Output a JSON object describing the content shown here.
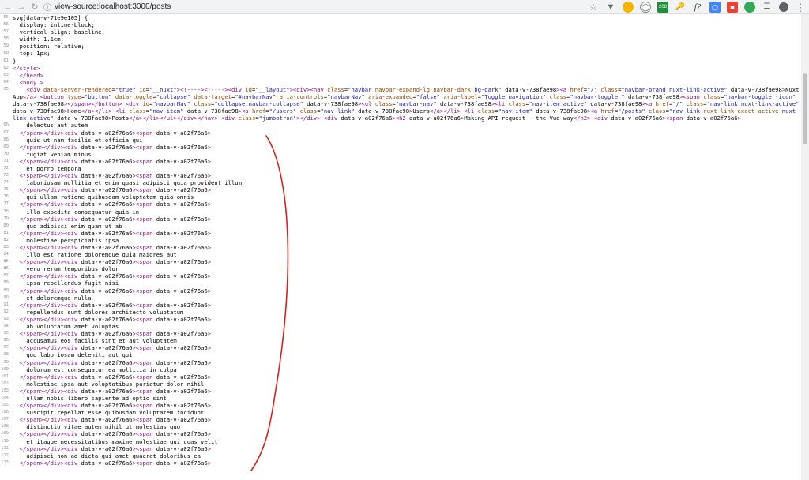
{
  "browser": {
    "url": "view-source:localhost:3000/posts",
    "extensions": [
      "star-icon",
      "vue-devtools-icon",
      "chrome-icon",
      "globe-icon",
      "badge-208-icon",
      "key-icon",
      "formula-icon",
      "screenshot-icon",
      "capture-icon",
      "extension-icon",
      "puzzle-icon"
    ],
    "badge": "208"
  },
  "source_lines": [
    {
      "n": "55",
      "t": "svg[data-v-71e9e105] {"
    },
    {
      "n": "56",
      "t": "  display: inline-block;"
    },
    {
      "n": "57",
      "t": "  vertical-align: baseline;"
    },
    {
      "n": "58",
      "t": "  width: 1.1em;"
    },
    {
      "n": "59",
      "t": "  position: relative;"
    },
    {
      "n": "60",
      "t": "  top: 1px;"
    },
    {
      "n": "61",
      "t": "}"
    },
    {
      "n": "62",
      "t": "</style>"
    },
    {
      "n": "63",
      "t": "  </head>"
    },
    {
      "n": "64",
      "t": "  <body >"
    },
    {
      "n": "65",
      "t": "    <div data-server-rendered=\"true\" id=\"__nuxt\"><!----><!----><div id=\"__layout\"><div><nav class=\"navbar navbar-expand-lg navbar-dark bg-dark\" data-v-738fae98><a href=\"/\" class=\"navbar-brand nuxt-link-active\" data-v-738fae98>Nuxt App</a> <button type=\"button\" data-toggle=\"collapse\" data-target=\"#navbarNav\" aria-controls=\"navbarNav\" aria-expanded=\"false\" aria-label=\"Toggle navigation\" class=\"navbar-toggler\" data-v-738fae98><span class=\"navbar-toggler-icon\" data-v-738fae98></span></button> <div id=\"navbarNav\" class=\"collapse navbar-collapse\" data-v-738fae98><ul class=\"navbar-nav\" data-v-738fae98><li class=\"nav-item active\" data-v-738fae98><a href=\"/\" class=\"nav-link nuxt-link-active\" data-v-738fae98>Home</a></li> <li class=\"nav-item\" data-v-738fae98><a href=\"/users\" class=\"nav-link\" data-v-738fae98>Users</a></li> <li class=\"nav-item\" data-v-738fae98><a href=\"/posts\" class=\"nav-link nuxt-link-exact-active nuxt-link-active\" data-v-738fae98>Posts</a></li></ul></div></nav> <div class=\"jumbotron\"></div> <div data-v-a02f76a6><h2 data-v-a02f76a6>Making API request - the Vue way</h2> <div data-v-a02f76a6><span data-v-a02f76a6>"
    },
    {
      "n": "66",
      "t": "    delectus aut autem"
    },
    {
      "n": "67",
      "t": "  </span></div><div data-v-a02f76a6><span data-v-a02f76a6>"
    },
    {
      "n": "68",
      "t": "    quis ut nam facilis et officia qui"
    },
    {
      "n": "69",
      "t": "  </span></div><div data-v-a02f76a6><span data-v-a02f76a6>"
    },
    {
      "n": "70",
      "t": "    fugiat veniam minus"
    },
    {
      "n": "71",
      "t": "  </span></div><div data-v-a02f76a6><span data-v-a02f76a6>"
    },
    {
      "n": "72",
      "t": "    et porro tempora"
    },
    {
      "n": "73",
      "t": "  </span></div><div data-v-a02f76a6><span data-v-a02f76a6>"
    },
    {
      "n": "74",
      "t": "    laboriosam mollitia et enim quasi adipisci quia provident illum"
    },
    {
      "n": "75",
      "t": "  </span></div><div data-v-a02f76a6><span data-v-a02f76a6>"
    },
    {
      "n": "76",
      "t": "    qui ullam ratione quibusdam voluptatem quia omnis"
    },
    {
      "n": "77",
      "t": "  </span></div><div data-v-a02f76a6><span data-v-a02f76a6>"
    },
    {
      "n": "78",
      "t": "    illo expedita consequatur quia in"
    },
    {
      "n": "79",
      "t": "  </span></div><div data-v-a02f76a6><span data-v-a02f76a6>"
    },
    {
      "n": "80",
      "t": "    quo adipisci enim quam ut ab"
    },
    {
      "n": "81",
      "t": "  </span></div><div data-v-a02f76a6><span data-v-a02f76a6>"
    },
    {
      "n": "82",
      "t": "    molestiae perspiciatis ipsa"
    },
    {
      "n": "83",
      "t": "  </span></div><div data-v-a02f76a6><span data-v-a02f76a6>"
    },
    {
      "n": "84",
      "t": "    illo est ratione doloremque quia maiores aut"
    },
    {
      "n": "85",
      "t": "  </span></div><div data-v-a02f76a6><span data-v-a02f76a6>"
    },
    {
      "n": "86",
      "t": "    vero rerum temporibus dolor"
    },
    {
      "n": "87",
      "t": "  </span></div><div data-v-a02f76a6><span data-v-a02f76a6>"
    },
    {
      "n": "88",
      "t": "    ipsa repellendus fugit nisi"
    },
    {
      "n": "89",
      "t": "  </span></div><div data-v-a02f76a6><span data-v-a02f76a6>"
    },
    {
      "n": "90",
      "t": "    et doloremque nulla"
    },
    {
      "n": "91",
      "t": "  </span></div><div data-v-a02f76a6><span data-v-a02f76a6>"
    },
    {
      "n": "92",
      "t": "    repellendus sunt dolores architecto voluptatum"
    },
    {
      "n": "93",
      "t": "  </span></div><div data-v-a02f76a6><span data-v-a02f76a6>"
    },
    {
      "n": "94",
      "t": "    ab voluptatum amet voluptas"
    },
    {
      "n": "95",
      "t": "  </span></div><div data-v-a02f76a6><span data-v-a02f76a6>"
    },
    {
      "n": "96",
      "t": "    accusamus eos facilis sint et aut voluptatem"
    },
    {
      "n": "97",
      "t": "  </span></div><div data-v-a02f76a6><span data-v-a02f76a6>"
    },
    {
      "n": "98",
      "t": "    quo laboriosam deleniti aut qui"
    },
    {
      "n": "99",
      "t": "  </span></div><div data-v-a02f76a6><span data-v-a02f76a6>"
    },
    {
      "n": "100",
      "t": "    dolorum est consequatur ea mollitia in culpa"
    },
    {
      "n": "101",
      "t": "  </span></div><div data-v-a02f76a6><span data-v-a02f76a6>"
    },
    {
      "n": "102",
      "t": "    molestiae ipsa aut voluptatibus pariatur dolor nihil"
    },
    {
      "n": "103",
      "t": "  </span></div><div data-v-a02f76a6><span data-v-a02f76a6>"
    },
    {
      "n": "104",
      "t": "    ullam nobis libero sapiente ad optio sint"
    },
    {
      "n": "105",
      "t": "  </span></div><div data-v-a02f76a6><span data-v-a02f76a6>"
    },
    {
      "n": "106",
      "t": "    suscipit repellat esse quibusdam voluptatem incidunt"
    },
    {
      "n": "107",
      "t": "  </span></div><div data-v-a02f76a6><span data-v-a02f76a6>"
    },
    {
      "n": "108",
      "t": "    distinctio vitae autem nihil ut molestias quo"
    },
    {
      "n": "109",
      "t": "  </span></div><div data-v-a02f76a6><span data-v-a02f76a6>"
    },
    {
      "n": "110",
      "t": "    et itaque necessitatibus maxime molestiae qui quas velit"
    },
    {
      "n": "111",
      "t": "  </span></div><div data-v-a02f76a6><span data-v-a02f76a6>"
    },
    {
      "n": "112",
      "t": "    adipisci non ad dicta qui amet quaerat doloribus ea"
    },
    {
      "n": "113",
      "t": "  </span></div><div data-v-a02f76a6><span data-v-a02f76a6>"
    }
  ],
  "colors": {
    "annotation": "#d9201c",
    "tag": "#881280",
    "attr": "#994500",
    "value": "#1a1aa6"
  }
}
